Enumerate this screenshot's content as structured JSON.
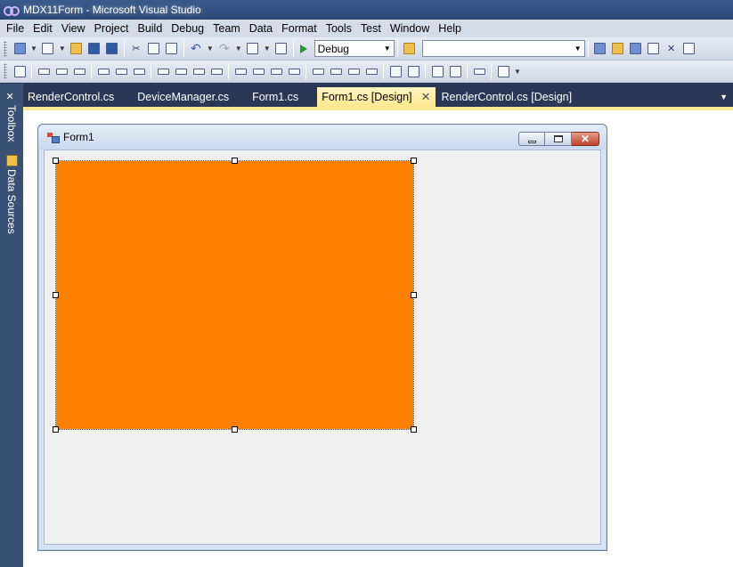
{
  "window": {
    "title": "MDX11Form - Microsoft Visual Studio"
  },
  "menu": [
    "File",
    "Edit",
    "View",
    "Project",
    "Build",
    "Debug",
    "Team",
    "Data",
    "Format",
    "Tools",
    "Test",
    "Window",
    "Help"
  ],
  "toolbar": {
    "configuration": "Debug",
    "find_value": ""
  },
  "sidebar": {
    "toolbox_label": "Toolbox",
    "datasources_label": "Data Sources"
  },
  "tabs": [
    {
      "label": "RenderControl.cs",
      "active": false
    },
    {
      "label": "DeviceManager.cs",
      "active": false
    },
    {
      "label": "Form1.cs",
      "active": false
    },
    {
      "label": "Form1.cs [Design]",
      "active": true
    },
    {
      "label": "RenderControl.cs [Design]",
      "active": false
    }
  ],
  "form": {
    "title": "Form1"
  },
  "render_control": {
    "color": "#ff8000"
  },
  "icons": {
    "min": "minimize-icon",
    "max": "maximize-icon",
    "close": "close-icon"
  }
}
